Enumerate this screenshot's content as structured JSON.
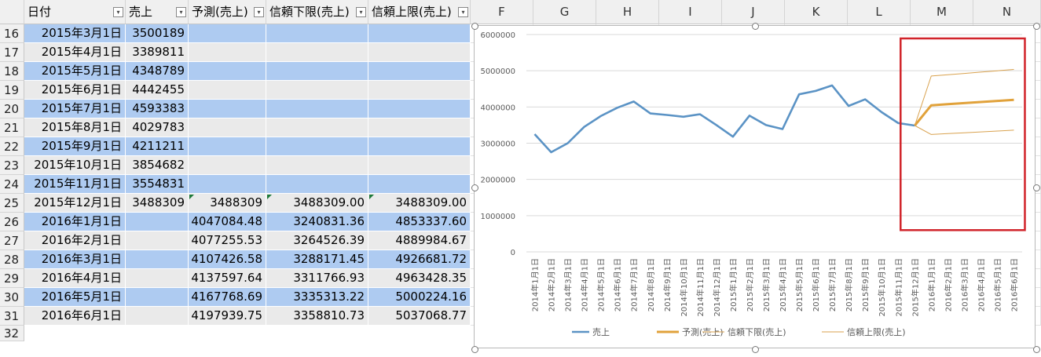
{
  "sheet": {
    "columns": [
      {
        "letter": "",
        "header": "日付",
        "filter": true
      },
      {
        "letter": "",
        "header": "売上",
        "filter": true
      },
      {
        "letter": "",
        "header": "予測(売上)",
        "filter": true
      },
      {
        "letter": "",
        "header": "信頼下限(売上)",
        "filter": true
      },
      {
        "letter": "",
        "header": "信頼上限(売上)",
        "filter": true
      },
      {
        "letter": "F",
        "header": "",
        "filter": false
      },
      {
        "letter": "G",
        "header": "",
        "filter": false
      },
      {
        "letter": "H",
        "header": "",
        "filter": false
      },
      {
        "letter": "I",
        "header": "",
        "filter": false
      },
      {
        "letter": "J",
        "header": "",
        "filter": false
      },
      {
        "letter": "K",
        "header": "",
        "filter": false
      },
      {
        "letter": "L",
        "header": "",
        "filter": false
      },
      {
        "letter": "M",
        "header": "",
        "filter": false
      },
      {
        "letter": "N",
        "header": "",
        "filter": false
      }
    ],
    "filter_glyph": "▾",
    "rows": [
      {
        "num": "16",
        "date": "2015年3月1日",
        "sales": "3500189",
        "forecast": "",
        "lower": "",
        "upper": ""
      },
      {
        "num": "17",
        "date": "2015年4月1日",
        "sales": "3389811",
        "forecast": "",
        "lower": "",
        "upper": ""
      },
      {
        "num": "18",
        "date": "2015年5月1日",
        "sales": "4348789",
        "forecast": "",
        "lower": "",
        "upper": ""
      },
      {
        "num": "19",
        "date": "2015年6月1日",
        "sales": "4442455",
        "forecast": "",
        "lower": "",
        "upper": ""
      },
      {
        "num": "20",
        "date": "2015年7月1日",
        "sales": "4593383",
        "forecast": "",
        "lower": "",
        "upper": ""
      },
      {
        "num": "21",
        "date": "2015年8月1日",
        "sales": "4029783",
        "forecast": "",
        "lower": "",
        "upper": ""
      },
      {
        "num": "22",
        "date": "2015年9月1日",
        "sales": "4211211",
        "forecast": "",
        "lower": "",
        "upper": ""
      },
      {
        "num": "23",
        "date": "2015年10月1日",
        "sales": "3854682",
        "forecast": "",
        "lower": "",
        "upper": ""
      },
      {
        "num": "24",
        "date": "2015年11月1日",
        "sales": "3554831",
        "forecast": "",
        "lower": "",
        "upper": ""
      },
      {
        "num": "25",
        "date": "2015年12月1日",
        "sales": "3488309",
        "forecast": "3488309",
        "lower": "3488309.00",
        "upper": "3488309.00"
      },
      {
        "num": "26",
        "date": "2016年1月1日",
        "sales": "",
        "forecast": "4047084.48",
        "lower": "3240831.36",
        "upper": "4853337.60"
      },
      {
        "num": "27",
        "date": "2016年2月1日",
        "sales": "",
        "forecast": "4077255.53",
        "lower": "3264526.39",
        "upper": "4889984.67"
      },
      {
        "num": "28",
        "date": "2016年3月1日",
        "sales": "",
        "forecast": "4107426.58",
        "lower": "3288171.45",
        "upper": "4926681.72"
      },
      {
        "num": "29",
        "date": "2016年4月1日",
        "sales": "",
        "forecast": "4137597.64",
        "lower": "3311766.93",
        "upper": "4963428.35"
      },
      {
        "num": "30",
        "date": "2016年5月1日",
        "sales": "",
        "forecast": "4167768.69",
        "lower": "3335313.22",
        "upper": "5000224.16"
      },
      {
        "num": "31",
        "date": "2016年6月1日",
        "sales": "",
        "forecast": "4197939.75",
        "lower": "3358810.73",
        "upper": "5037068.77"
      }
    ],
    "partial_row_num": "32"
  },
  "colors": {
    "band_a": "#aecbf1",
    "band_b": "#eaeaea",
    "sales_line": "#5b93c5",
    "forecast_line": "#e1a23b",
    "bound_line": "#d9a24f",
    "highlight_box": "#d1232a"
  },
  "chart_data": {
    "type": "line",
    "categories": [
      "2014年1月1日",
      "2014年2月1日",
      "2014年3月1日",
      "2014年4月1日",
      "2014年5月1日",
      "2014年6月1日",
      "2014年7月1日",
      "2014年8月1日",
      "2014年9月1日",
      "2014年10月1日",
      "2014年11月1日",
      "2014年12月1日",
      "2015年1月1日",
      "2015年2月1日",
      "2015年3月1日",
      "2015年4月1日",
      "2015年5月1日",
      "2015年6月1日",
      "2015年7月1日",
      "2015年8月1日",
      "2015年9月1日",
      "2015年10月1日",
      "2015年11月1日",
      "2015年12月1日",
      "2016年1月1日",
      "2016年2月1日",
      "2016年3月1日",
      "2016年4月1日",
      "2016年5月1日",
      "2016年6月1日"
    ],
    "series": [
      {
        "name": "売上",
        "values": [
          3250000,
          2750000,
          3000000,
          3450000,
          3750000,
          3980000,
          4150000,
          3820000,
          3780000,
          3730000,
          3800000,
          3500000,
          3180000,
          3760000,
          3500189,
          3389811,
          4348789,
          4442455,
          4593383,
          4029783,
          4211211,
          3854682,
          3554831,
          3488309,
          null,
          null,
          null,
          null,
          null,
          null
        ]
      },
      {
        "name": "予測(売上)",
        "values": [
          null,
          null,
          null,
          null,
          null,
          null,
          null,
          null,
          null,
          null,
          null,
          null,
          null,
          null,
          null,
          null,
          null,
          null,
          null,
          null,
          null,
          null,
          null,
          3488309,
          4047084.48,
          4077255.53,
          4107426.58,
          4137597.64,
          4167768.69,
          4197939.75
        ]
      },
      {
        "name": "信頼下限(売上)",
        "values": [
          null,
          null,
          null,
          null,
          null,
          null,
          null,
          null,
          null,
          null,
          null,
          null,
          null,
          null,
          null,
          null,
          null,
          null,
          null,
          null,
          null,
          null,
          null,
          3488309,
          3240831.36,
          3264526.39,
          3288171.45,
          3311766.93,
          3335313.22,
          3358810.73
        ]
      },
      {
        "name": "信頼上限(売上)",
        "values": [
          null,
          null,
          null,
          null,
          null,
          null,
          null,
          null,
          null,
          null,
          null,
          null,
          null,
          null,
          null,
          null,
          null,
          null,
          null,
          null,
          null,
          null,
          null,
          3488309,
          4853337.6,
          4889984.67,
          4926681.72,
          4963428.35,
          5000224.16,
          5037068.77
        ]
      }
    ],
    "y_ticks": [
      "0",
      "1000000",
      "2000000",
      "3000000",
      "4000000",
      "5000000",
      "6000000"
    ],
    "ylim": [
      0,
      6000000
    ],
    "grid": true,
    "legend": "bottom",
    "highlight": {
      "from_index": 23,
      "to_index": 29
    }
  }
}
